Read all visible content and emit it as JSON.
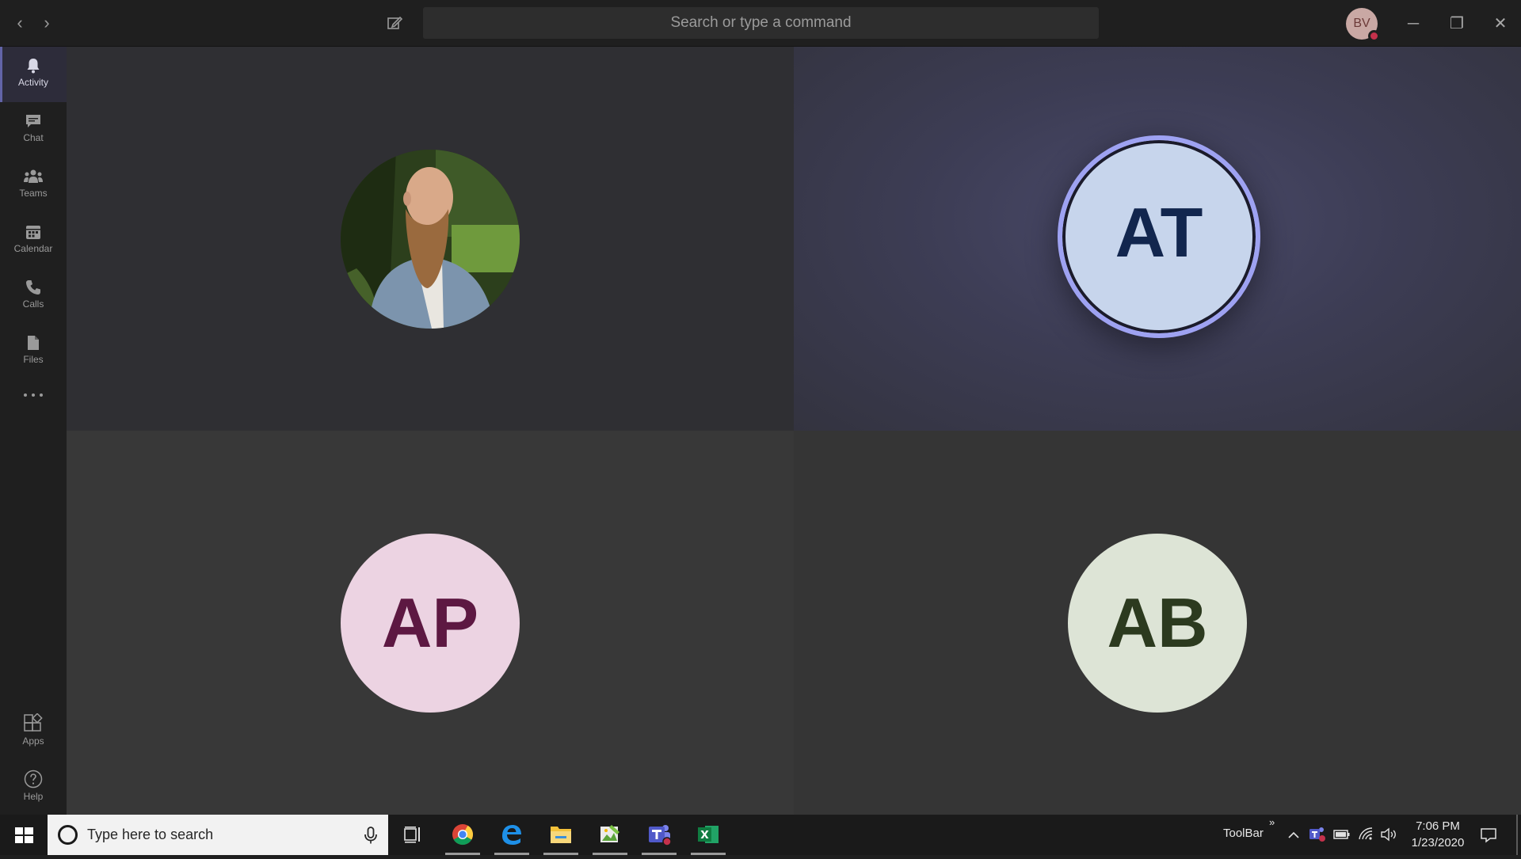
{
  "titlebar": {
    "search_placeholder": "Search or type a command",
    "user_initials": "BV"
  },
  "rail": {
    "items": [
      {
        "label": "Activity",
        "icon": "bell-icon",
        "active": true
      },
      {
        "label": "Chat",
        "icon": "chat-icon"
      },
      {
        "label": "Teams",
        "icon": "teams-icon"
      },
      {
        "label": "Calendar",
        "icon": "calendar-icon"
      },
      {
        "label": "Calls",
        "icon": "phone-icon"
      },
      {
        "label": "Files",
        "icon": "file-icon"
      },
      {
        "label": "Apps",
        "icon": "apps-icon"
      },
      {
        "label": "Help",
        "icon": "help-icon"
      }
    ]
  },
  "participants": [
    {
      "type": "photo"
    },
    {
      "initials": "AT",
      "speaking": true
    },
    {
      "initials": "AP"
    },
    {
      "initials": "AB"
    }
  ],
  "taskbar": {
    "search_placeholder": "Type here to search",
    "toolbar_label": "ToolBar",
    "time": "7:06 PM",
    "date": "1/23/2020"
  }
}
